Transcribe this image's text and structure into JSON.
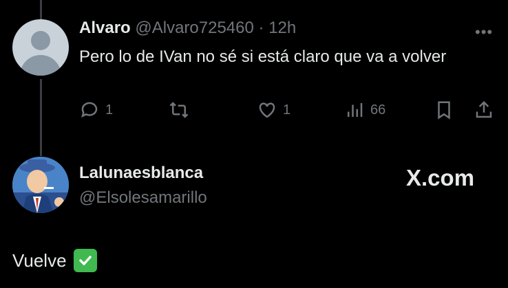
{
  "reply": {
    "display_name": "Alvaro",
    "handle": "@Alvaro725460",
    "separator": "·",
    "time": "12h",
    "more_icon": "more-dots-icon",
    "text": "Pero lo de IVan no sé si está claro que va a volver",
    "actions": {
      "reply_count": "1",
      "retweet_count": "",
      "like_count": "1",
      "views_count": "66"
    }
  },
  "quote": {
    "display_name": "Lalunaesblanca",
    "handle": "@Elsolesamarillo",
    "body": "Vuelve",
    "emoji": "check-mark-button-icon"
  },
  "brand": "X.com",
  "colors": {
    "background": "#000000",
    "text_primary": "#e7e9ea",
    "text_secondary": "#71767b",
    "check_green": "#3fb950"
  }
}
